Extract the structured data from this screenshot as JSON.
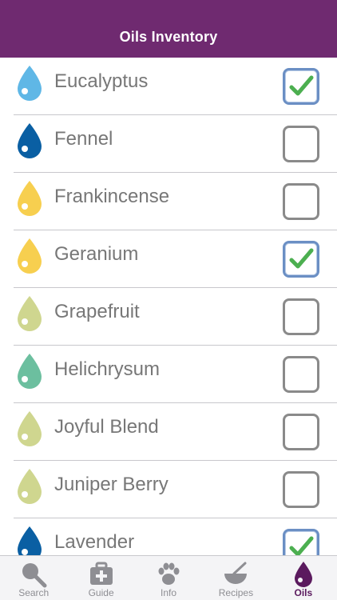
{
  "header": {
    "title": "Oils Inventory"
  },
  "oils": [
    {
      "name": "Eucalyptus",
      "drop_color": "#5fb7e6",
      "checked": true
    },
    {
      "name": "Fennel",
      "drop_color": "#0a5fa3",
      "checked": false
    },
    {
      "name": "Frankincense",
      "drop_color": "#f7cf4f",
      "checked": false
    },
    {
      "name": "Geranium",
      "drop_color": "#f7cf4f",
      "checked": true
    },
    {
      "name": "Grapefruit",
      "drop_color": "#cfd68f",
      "checked": false
    },
    {
      "name": "Helichrysum",
      "drop_color": "#6cbf9f",
      "checked": false
    },
    {
      "name": "Joyful Blend",
      "drop_color": "#cfd68f",
      "checked": false
    },
    {
      "name": "Juniper Berry",
      "drop_color": "#cfd68f",
      "checked": false
    },
    {
      "name": "Lavender",
      "drop_color": "#0a5fa3",
      "checked": true
    }
  ],
  "tabs": [
    {
      "label": "Search",
      "icon": "search-icon",
      "active": false
    },
    {
      "label": "Guide",
      "icon": "first-aid-icon",
      "active": false
    },
    {
      "label": "Info",
      "icon": "paw-icon",
      "active": false
    },
    {
      "label": "Recipes",
      "icon": "bowl-icon",
      "active": false
    },
    {
      "label": "Oils",
      "icon": "oil-drop-icon",
      "active": true
    }
  ],
  "colors": {
    "brand": "#6f2a70",
    "check_green": "#4caf50",
    "tab_inactive": "#8e8e93",
    "tab_active": "#5b1a5e"
  }
}
